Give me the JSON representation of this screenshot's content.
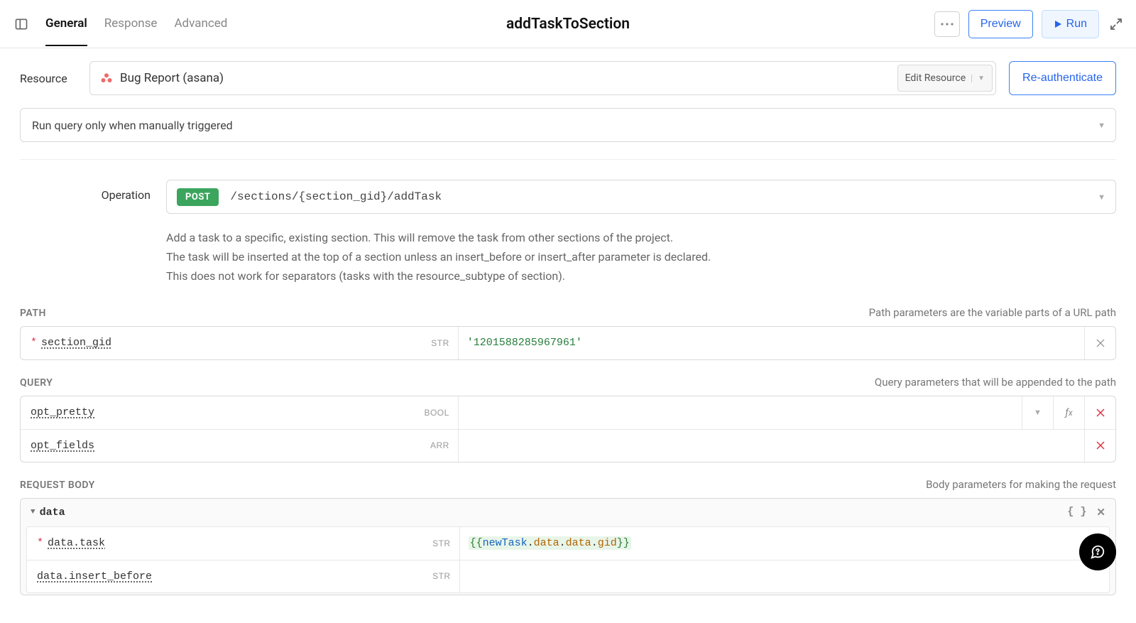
{
  "header": {
    "tabs": [
      "General",
      "Response",
      "Advanced"
    ],
    "active_tab": 0,
    "title": "addTaskToSection",
    "preview_label": "Preview",
    "run_label": "Run"
  },
  "resource": {
    "label": "Resource",
    "name": "Bug Report (asana)",
    "edit_label": "Edit Resource",
    "reauth_label": "Re-authenticate"
  },
  "trigger": {
    "text": "Run query only when manually triggered"
  },
  "operation": {
    "label": "Operation",
    "method": "POST",
    "path": "/sections/{section_gid}/addTask",
    "description_lines": [
      "Add a task to a specific, existing section. This will remove the task from other sections of the project.",
      "The task will be inserted at the top of a section unless an insert_before or insert_after parameter is declared.",
      "This does not work for separators (tasks with the resource_subtype of section)."
    ]
  },
  "path_section": {
    "title": "PATH",
    "hint": "Path parameters are the variable parts of a URL path",
    "params": [
      {
        "name": "section_gid",
        "required": true,
        "type": "STR",
        "value": "'1201588285967961'"
      }
    ]
  },
  "query_section": {
    "title": "QUERY",
    "hint": "Query parameters that will be appended to the path",
    "params": [
      {
        "name": "opt_pretty",
        "required": false,
        "type": "BOOL",
        "value": ""
      },
      {
        "name": "opt_fields",
        "required": false,
        "type": "ARR",
        "value": ""
      }
    ]
  },
  "body_section": {
    "title": "REQUEST BODY",
    "hint": "Body parameters for making the request",
    "group_name": "data",
    "params": [
      {
        "name": "data.task",
        "required": true,
        "type": "STR",
        "value": "{{newTask.data.data.gid}}"
      },
      {
        "name": "data.insert_before",
        "required": false,
        "type": "STR",
        "value": ""
      }
    ]
  }
}
